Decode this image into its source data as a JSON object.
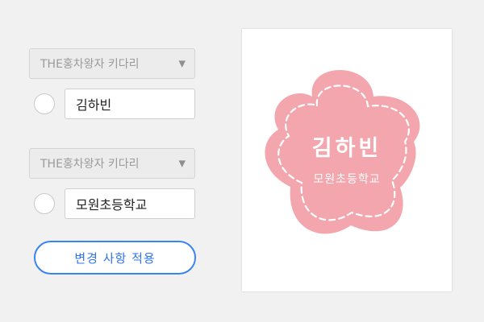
{
  "form": {
    "name_font_select": {
      "value": "THE홍차왕자 키다리"
    },
    "name_input": {
      "value": "김하빈"
    },
    "school_font_select": {
      "value": "THE홍차왕자 키다리"
    },
    "school_input": {
      "value": "모원초등학교"
    },
    "apply_button_label": "변경 사항 적용"
  },
  "preview": {
    "name_text": "김하빈",
    "school_text": "모원초등학교",
    "label_color": "#f3a6ae",
    "stitch_color": "#ffffff"
  },
  "icons": {
    "select_caret": "▼"
  }
}
